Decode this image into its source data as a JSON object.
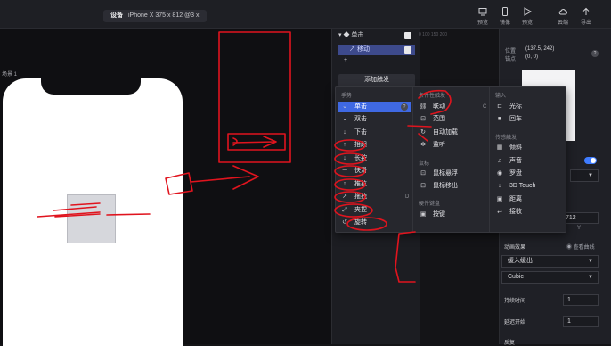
{
  "topbar": {
    "device_label": "设备",
    "device_value": "iPhone X  375 x 812  @3 x",
    "tools": [
      {
        "icon": "monitor-icon",
        "label": "预览"
      },
      {
        "icon": "phone-icon",
        "label": "镜像"
      },
      {
        "icon": "play-icon",
        "label": "预览"
      },
      {
        "icon": "cloud-icon",
        "label": "云端"
      },
      {
        "icon": "upload-icon",
        "label": "导出"
      }
    ]
  },
  "canvas": {
    "scene_label": "场景 1"
  },
  "layers": {
    "title": "单击",
    "row": "移动",
    "add_row": "+",
    "add_button": "添加触发"
  },
  "ruler": {
    "text": "0  100  150  200"
  },
  "properties": {
    "pos_label": "位置",
    "pos_value": "(137.5, 242)",
    "anchor_label": "锚点",
    "anchor_value": "(0, 0)",
    "help": "?",
    "coord_value": "712",
    "coord_axis": "Y",
    "anim_label": "动画效果",
    "view_curve": "查看曲线",
    "ease_select": "缓入缓出",
    "curve_select": "Cubic",
    "duration_label": "持续时间",
    "duration_value": "1",
    "delay_label": "延迟开始",
    "delay_value": "1",
    "reverse_label": "反复"
  },
  "popup": {
    "gestures": {
      "title": "手势",
      "items": [
        {
          "icon": "tap-icon",
          "label": "单击"
        },
        {
          "icon": "double-tap-icon",
          "label": "双击"
        },
        {
          "icon": "press-down-icon",
          "label": "下击"
        },
        {
          "icon": "lift-icon",
          "label": "抬起"
        },
        {
          "icon": "long-press-icon",
          "label": "长按"
        },
        {
          "icon": "swipe-icon",
          "label": "快滑"
        },
        {
          "icon": "push-icon",
          "label": "推拉"
        },
        {
          "icon": "drag-icon",
          "label": "拖拽"
        },
        {
          "icon": "pinch-icon",
          "label": "夹捏"
        },
        {
          "icon": "rotate-icon",
          "label": "旋转"
        }
      ],
      "help": "?",
      "d_hint": "D"
    },
    "conditions": {
      "title": "条件性触发",
      "items": [
        {
          "icon": "link-icon",
          "label": "联动"
        },
        {
          "icon": "range-icon",
          "label": "范围"
        },
        {
          "icon": "autoload-icon",
          "label": "自动加载"
        },
        {
          "icon": "listen-icon",
          "label": "监听"
        }
      ],
      "mouse_title": "鼠标",
      "mouse_items": [
        {
          "icon": "hover-icon",
          "label": "鼠标悬浮"
        },
        {
          "icon": "mouse-out-icon",
          "label": "鼠标移出"
        }
      ],
      "keyboard_title": "硬件键盘",
      "keyboard_items": [
        {
          "icon": "key-icon",
          "label": "按键"
        }
      ],
      "c_hint": "C"
    },
    "inputs": {
      "title": "输入",
      "items": [
        {
          "icon": "cursor-icon",
          "label": "光标"
        },
        {
          "icon": "enter-icon",
          "label": "回车"
        }
      ],
      "sensor_title": "传感触发",
      "sensor_items": [
        {
          "icon": "tilt-icon",
          "label": "倾斜"
        },
        {
          "icon": "sound-icon",
          "label": "声音"
        },
        {
          "icon": "compass-icon",
          "label": "罗盘"
        },
        {
          "icon": "touch-icon",
          "label": "3D Touch"
        },
        {
          "icon": "distance-icon",
          "label": "距离"
        },
        {
          "icon": "receive-icon",
          "label": "接收"
        }
      ]
    }
  },
  "colors": {
    "accent": "#3f69e3",
    "layer_row": "#3d4a8c",
    "annotation": "#e0141e"
  }
}
